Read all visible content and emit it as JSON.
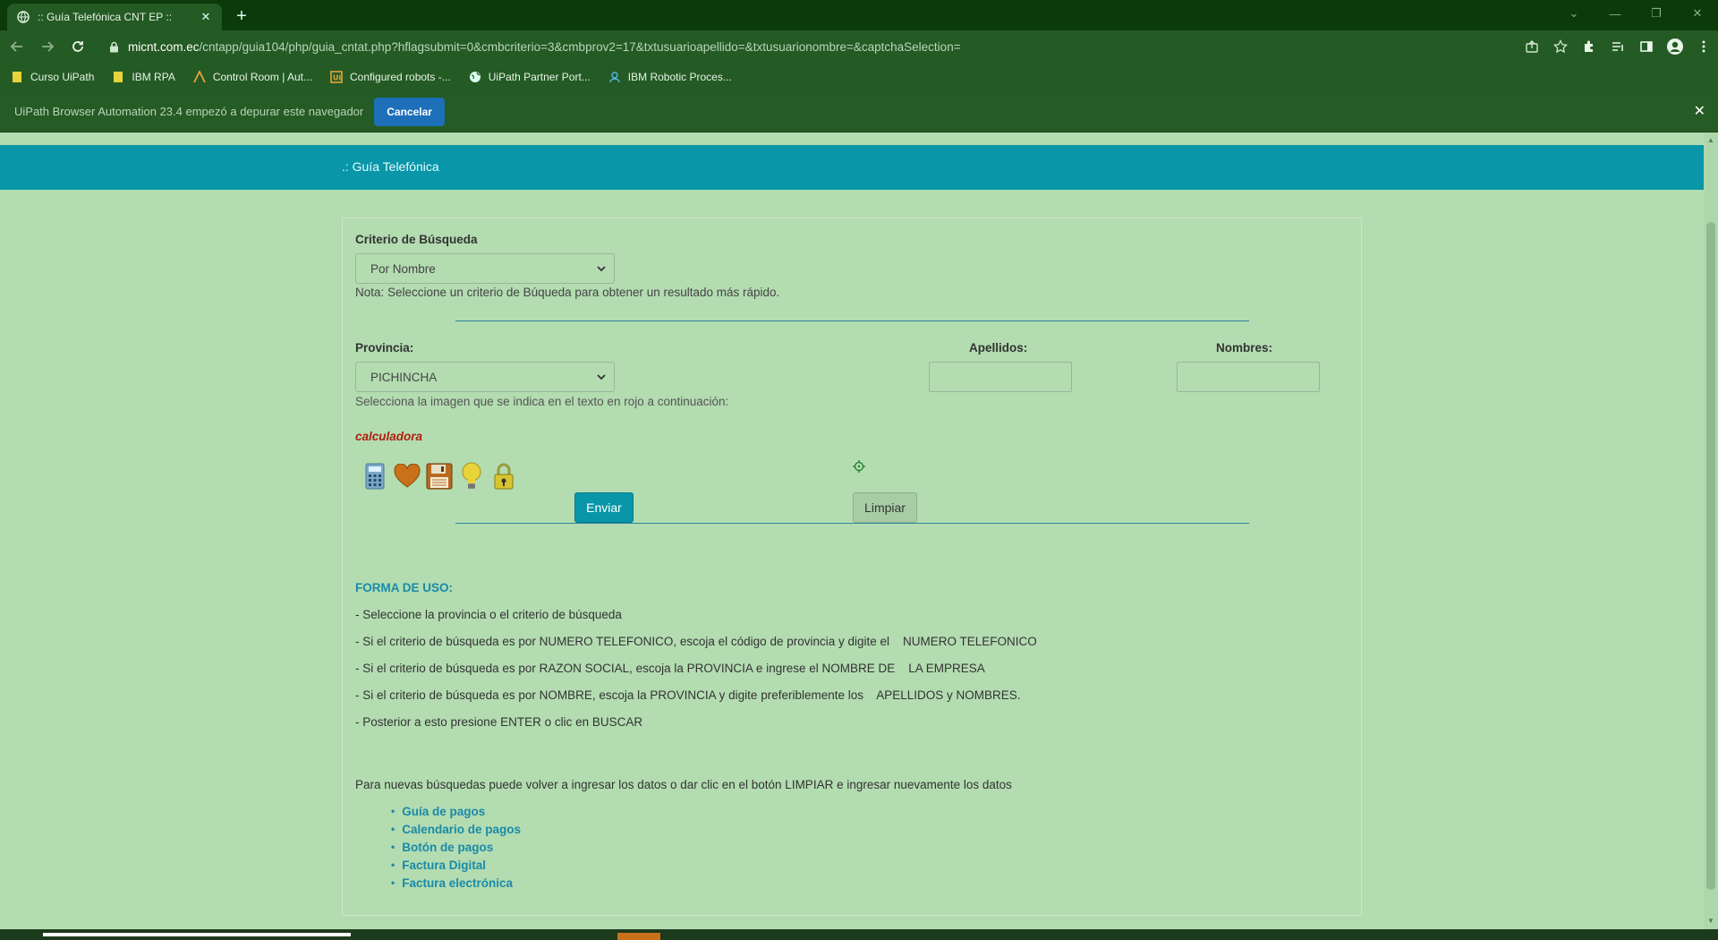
{
  "browser": {
    "tab_title": ":: Guía Telefónica CNT EP ::",
    "url_host": "micnt.com.ec",
    "url_path": "/cntapp/guia104/php/guia_cntat.php?hflagsubmit=0&cmbcriterio=3&cmbprov2=17&txtusuarioapellido=&txtusuarionombre=&captchaSelection=",
    "bookmarks": [
      {
        "label": "Curso UiPath",
        "icon": "folder-icon"
      },
      {
        "label": "IBM RPA",
        "icon": "folder-icon"
      },
      {
        "label": "Control Room | Aut...",
        "icon": "automation-anywhere-icon"
      },
      {
        "label": "Configured robots -...",
        "icon": "uipath-icon"
      },
      {
        "label": "UiPath Partner Port...",
        "icon": "globe-icon"
      },
      {
        "label": "IBM Robotic Proces...",
        "icon": "user-icon"
      }
    ],
    "infobar_message": "UiPath Browser Automation 23.4 empezó a depurar este navegador",
    "infobar_button": "Cancelar"
  },
  "page": {
    "banner_title": ".: Guía Telefónica",
    "criterio_label": "Criterio de Búsqueda",
    "criterio_value": "Por Nombre",
    "nota": "Nota: Seleccione un criterio de Búqueda para obtener un resultado más rápido.",
    "provincia_label": "Provincia:",
    "provincia_value": "PICHINCHA",
    "apellidos_label": "Apellidos:",
    "nombres_label": "Nombres:",
    "apellidos_value": "",
    "nombres_value": "",
    "captcha_instruction": "Selecciona la imagen que se indica en el texto en rojo a continuación:",
    "captcha_word": "calculadora",
    "captcha_icons": [
      "calculator-icon",
      "heart-icon",
      "floppy-disk-icon",
      "lightbulb-icon",
      "padlock-icon"
    ],
    "send_button": "Enviar",
    "clear_button": "Limpiar",
    "howto_title": "FORMA DE USO:",
    "howto_lines": [
      "- Seleccione la provincia o el criterio de búsqueda",
      "- Si el criterio de búsqueda es por NUMERO TELEFONICO, escoja el código de provincia y digite el    NUMERO TELEFONICO",
      "- Si el criterio de búsqueda es por RAZON SOCIAL, escoja la PROVINCIA e ingrese el NOMBRE DE    LA EMPRESA",
      "- Si el criterio de búsqueda es por NOMBRE, escoja la PROVINCIA y digite preferiblemente los    APELLIDOS y NOMBRES.",
      "- Posterior a esto presione ENTER o clic en BUSCAR"
    ],
    "new_search_note": "Para nuevas búsquedas puede volver a ingresar los datos o dar clic en el botón LIMPIAR e ingresar nuevamente los datos",
    "links": [
      "Guía de pagos",
      "Calendario de pagos",
      "Botón de pagos",
      "Factura Digital",
      "Factura electrónica"
    ]
  },
  "colors": {
    "page_bg": "#b3dcb1",
    "banner": "#0896a8",
    "captcha_red": "#b0200e",
    "link": "#1a8aa8"
  }
}
